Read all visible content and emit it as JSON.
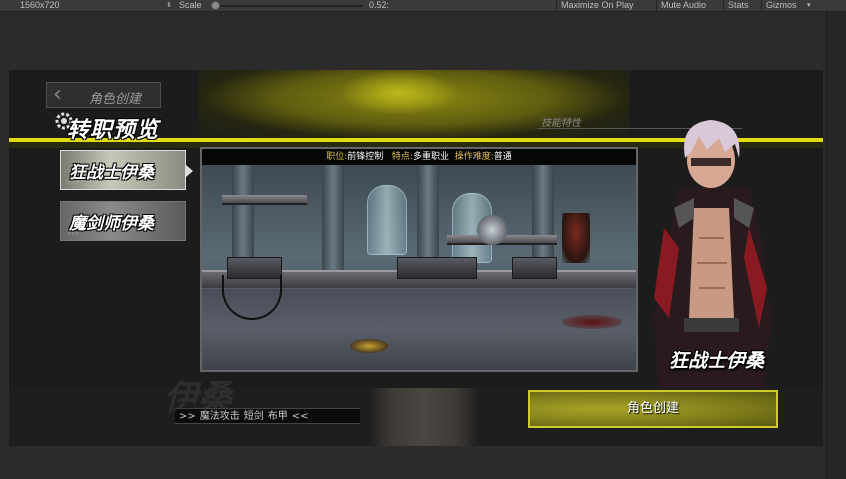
{
  "toolbar": {
    "resolution": "1560x720",
    "scale_label": "Scale",
    "scale_value": "0.52:",
    "scale_fraction": 0.0,
    "buttons": [
      "Maximize On Play",
      "Mute Audio",
      "Stats",
      "Gizmos"
    ]
  },
  "game": {
    "back_label": "角色创建",
    "title": "转职预览",
    "skill_label": "技能特性",
    "jobs": [
      {
        "label": "狂战士伊桑",
        "selected": true
      },
      {
        "label": "魔剑师伊桑",
        "selected": false
      }
    ],
    "preview": {
      "role_key": "职位:",
      "role_value": "前锋控制",
      "trait_key": "特点:",
      "trait_value": "多重职业",
      "difficulty_key": "操作难度:",
      "difficulty_value": "普通"
    },
    "character_name": "狂战士伊桑",
    "bottom_bg_text": "伊桑",
    "attributes": [
      ">>",
      "魔法攻击",
      "短剑",
      "布甲",
      "<<"
    ],
    "create_button": "角色创建",
    "colors": {
      "accent_yellow": "#e0dc14",
      "button_olive": "#8c8a22",
      "info_key": "#e3c14a"
    }
  }
}
